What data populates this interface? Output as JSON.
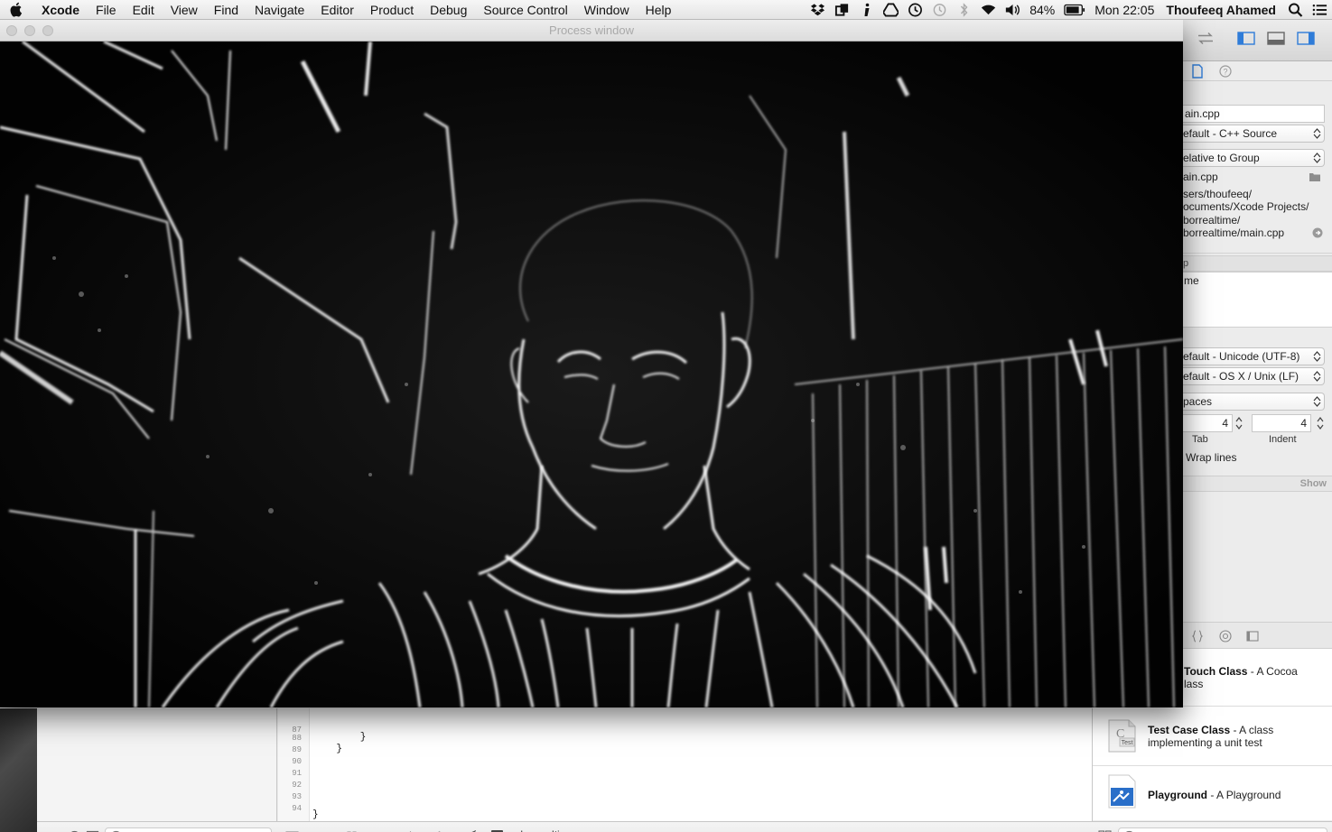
{
  "menubar": {
    "app_name": "Xcode",
    "menus": [
      "File",
      "Edit",
      "View",
      "Find",
      "Navigate",
      "Editor",
      "Product",
      "Debug",
      "Source Control",
      "Window",
      "Help"
    ],
    "battery_percent": "84%",
    "clock": "Mon 22:05",
    "user": "Thoufeeq Ahamed"
  },
  "process_window": {
    "title": "Process window",
    "content": "edge-filtered webcam frame"
  },
  "inspector": {
    "file_name": "ain.cpp",
    "file_type": "efault - C++ Source",
    "location": "elative to Group",
    "full_path_name": "ain.cpp",
    "full_path_lines": [
      "sers/thoufeeq/",
      "ocuments/Xcode Projects/",
      "borrealtime/",
      "borrealtime/main.cpp"
    ],
    "target_header": "p",
    "target_item": "me",
    "text_encoding": "efault - Unicode (UTF-8)",
    "line_endings": "efault - OS X / Unix (LF)",
    "indent_using": "paces",
    "tab_width": "4",
    "indent_width": "4",
    "tab_label": "Tab",
    "indent_label": "Indent",
    "wrap_lines": "Wrap lines",
    "show_label": "Show"
  },
  "library": {
    "items": [
      {
        "title": "Touch Class",
        "desc": " - A Cocoa",
        "desc2": "lass"
      },
      {
        "title": "Test Case Class",
        "desc": " - A class",
        "desc2": "implementing a unit test",
        "icon_text": "Test"
      },
      {
        "title": "Playground",
        "desc": " - A Playground"
      }
    ]
  },
  "editor": {
    "line_numbers": [
      "87",
      "88",
      "89",
      "90",
      "91",
      "92",
      "93",
      "94"
    ],
    "code_lines": [
      "        }",
      "    }",
      "",
      "",
      "",
      "",
      "",
      "}"
    ]
  },
  "debug_bar": {
    "scheme": "gaborrealtime"
  },
  "colors": {
    "menubar_bg": "#ececec",
    "breakpoint_blue": "#3b8ee8",
    "playground_blue": "#2a6fc9"
  }
}
